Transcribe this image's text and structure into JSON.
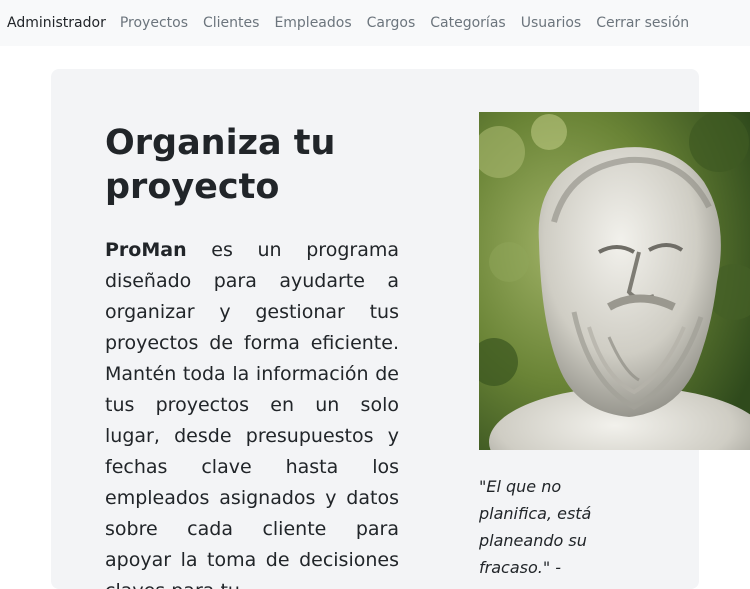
{
  "navbar": {
    "brand": "Administrador",
    "links": [
      "Proyectos",
      "Clientes",
      "Empleados",
      "Cargos",
      "Categorías",
      "Usuarios",
      "Cerrar sesión"
    ]
  },
  "hero": {
    "title": "Organiza tu proyecto",
    "brand_word": "ProMan",
    "description": " es un programa diseñado para ayudarte a organizar y gestionar tus proyectos de forma eficiente. Mantén toda la información de tus proyectos en un solo lugar, desde presupuestos y fechas clave hasta los empleados asignados y datos sobre cada cliente para apoyar la toma de decisiones claves para tu",
    "quote": "\"El que no planifica, está planeando su fracaso.\" -"
  },
  "colors": {
    "navbar_bg": "#f8f9fa",
    "hero_bg": "#f3f4f6",
    "text": "#212529",
    "nav_link": "#6c757d"
  }
}
